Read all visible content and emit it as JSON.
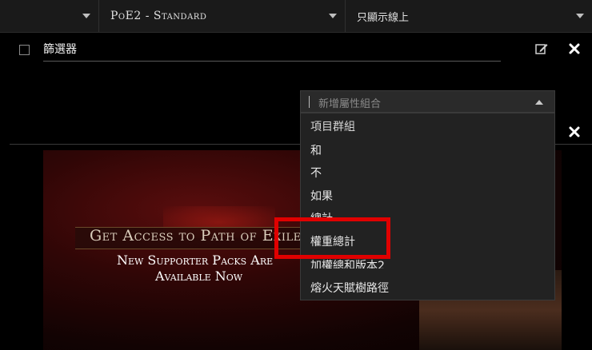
{
  "topbar": {
    "selects": [
      {
        "value": ""
      },
      {
        "value": "PoE2 - Standard"
      },
      {
        "value": "只顯示線上"
      }
    ]
  },
  "filter": {
    "title": "篩選器"
  },
  "dropdown": {
    "placeholder": "新增屬性組合",
    "items": [
      "項目群組",
      "和",
      "不",
      "如果",
      "總計",
      "權重總計",
      "加權總和版本2",
      "熔火天賦樹路徑"
    ]
  },
  "banner": {
    "headline": "Get Access to Path of Exile",
    "line1": "New Supporter Packs Are",
    "line2": "Available Now"
  },
  "colors": {
    "background": "#000000",
    "panel": "#222222",
    "highlight": "#e00000"
  }
}
